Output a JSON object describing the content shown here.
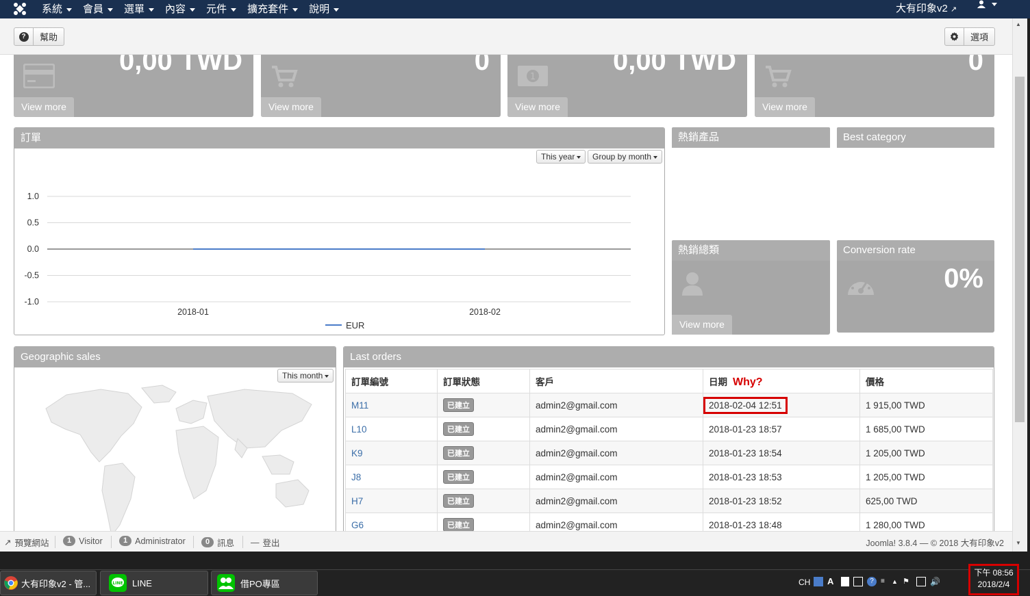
{
  "nav": {
    "menu": [
      "系統",
      "會員",
      "選單",
      "內容",
      "元件",
      "擴充套件",
      "說明"
    ],
    "site": "大有印象v2"
  },
  "toolbar": {
    "help": "幫助",
    "options": "選項"
  },
  "stats": [
    {
      "value": "0,00 TWD",
      "link": "View more",
      "icon": "credit-card-icon"
    },
    {
      "value": "0",
      "link": "View more",
      "icon": "cart-icon"
    },
    {
      "value": "0,00 TWD",
      "link": "View more",
      "icon": "money-icon"
    },
    {
      "value": "0",
      "link": "View more",
      "icon": "cart-icon"
    }
  ],
  "orders_panel": {
    "title": "訂單",
    "range": "This year",
    "group": "Group by month"
  },
  "chart_data": {
    "type": "line",
    "x": [
      "2018-01",
      "2018-02"
    ],
    "series": [
      {
        "name": "EUR",
        "values": [
          0,
          0
        ]
      }
    ],
    "ylim": [
      -1.0,
      1.0
    ],
    "yticks": [
      "1.0",
      "0.5",
      "0.0",
      "-0.5",
      "-1.0"
    ],
    "legend": "bottom",
    "grid": true,
    "color": "#4a7cc9"
  },
  "top_products": {
    "title": "熱銷產品"
  },
  "best_category": {
    "title": "Best category"
  },
  "top_categories": {
    "title": "熱銷總類",
    "link": "View more",
    "icon": "user-icon"
  },
  "conversion": {
    "title": "Conversion rate",
    "value": "0%",
    "icon": "dashboard-icon"
  },
  "geo": {
    "title": "Geographic sales",
    "range": "This month"
  },
  "last_orders": {
    "title": "Last orders",
    "annotation": "Why?",
    "columns": [
      "訂單編號",
      "訂單狀態",
      "客戶",
      "日期",
      "價格"
    ],
    "rows": [
      {
        "id": "M11",
        "status": "已建立",
        "customer": "admin2@gmail.com",
        "date": "2018-02-04 12:51",
        "price": "1 915,00 TWD"
      },
      {
        "id": "L10",
        "status": "已建立",
        "customer": "admin2@gmail.com",
        "date": "2018-01-23 18:57",
        "price": "1 685,00 TWD"
      },
      {
        "id": "K9",
        "status": "已建立",
        "customer": "admin2@gmail.com",
        "date": "2018-01-23 18:54",
        "price": "1 205,00 TWD"
      },
      {
        "id": "J8",
        "status": "已建立",
        "customer": "admin2@gmail.com",
        "date": "2018-01-23 18:53",
        "price": "1 205,00 TWD"
      },
      {
        "id": "H7",
        "status": "已建立",
        "customer": "admin2@gmail.com",
        "date": "2018-01-23 18:52",
        "price": "625,00 TWD"
      },
      {
        "id": "G6",
        "status": "已建立",
        "customer": "admin2@gmail.com",
        "date": "2018-01-23 18:48",
        "price": "1 280,00 TWD"
      }
    ]
  },
  "statusbar": {
    "preview": "預覽網站",
    "visitors_count": "1",
    "visitors": "Visitor",
    "admins_count": "1",
    "admins": "Administrator",
    "msgs_count": "0",
    "msgs": "訊息",
    "logout": "登出",
    "version": "Joomla! 3.8.4 — © 2018 大有印象v2"
  },
  "taskbar": {
    "tasks": [
      "大有印象v2 - 管...",
      "LINE",
      "借PO專區"
    ],
    "lang": "CH",
    "time": "下午 08:56",
    "date": "2018/2/4"
  }
}
